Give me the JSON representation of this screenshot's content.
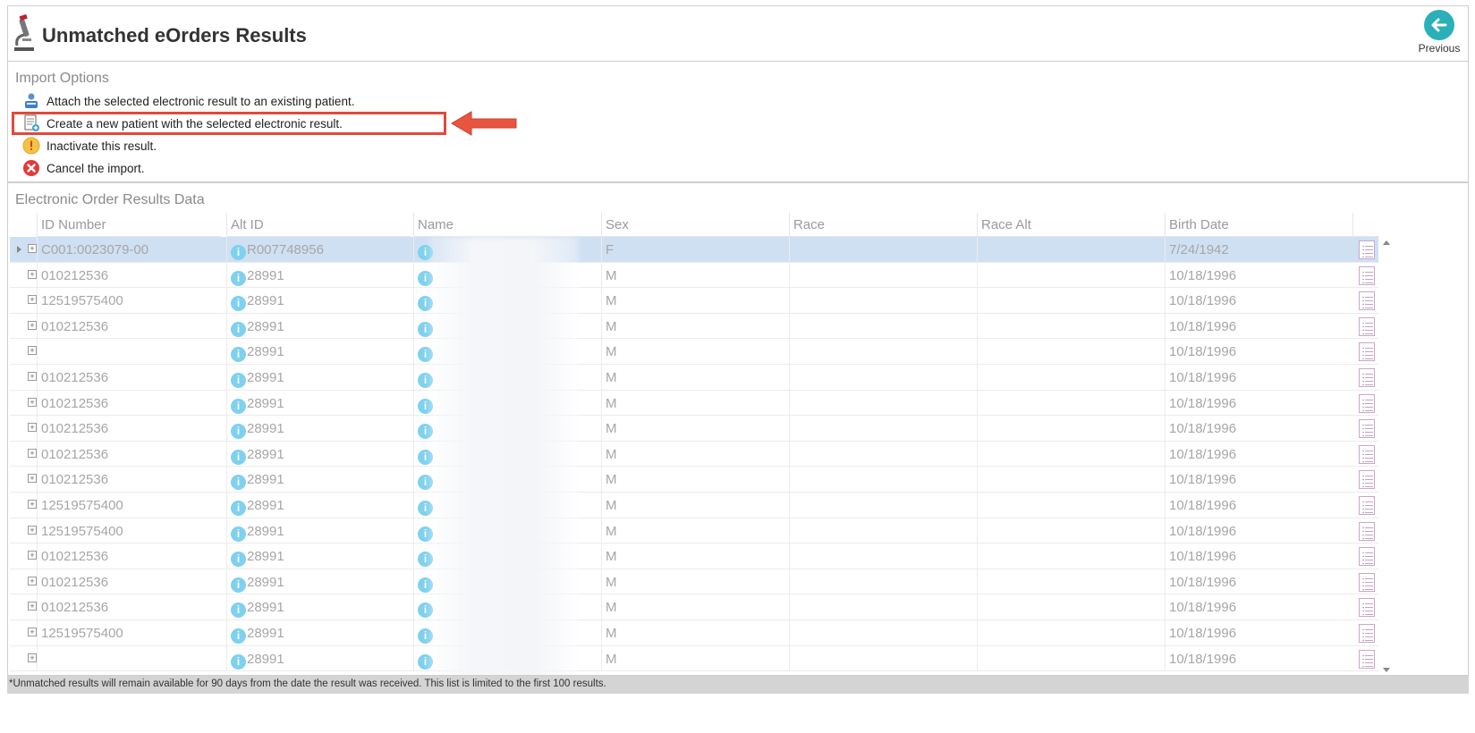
{
  "header": {
    "title": "Unmatched eOrders Results",
    "previous_label": "Previous"
  },
  "import_options": {
    "title": "Import Options",
    "items": [
      {
        "label": "Attach the selected electronic result to an existing patient.",
        "icon": "patient-attach-icon"
      },
      {
        "label": "Create a new patient with the selected electronic result.",
        "icon": "new-patient-document-icon"
      },
      {
        "label": "Inactivate this result.",
        "icon": "warning-icon"
      },
      {
        "label": "Cancel the import.",
        "icon": "cancel-icon"
      }
    ]
  },
  "data_panel": {
    "title": "Electronic Order Results Data",
    "columns": [
      "ID Number",
      "Alt ID",
      "Name",
      "Sex",
      "Race",
      "Race Alt",
      "Birth Date"
    ],
    "rows": [
      {
        "id": "C001:0023079-00",
        "alt": "R007748956",
        "sex": "F",
        "birth": "7/24/1942"
      },
      {
        "id": "010212536",
        "alt": "28991",
        "sex": "M",
        "birth": "10/18/1996"
      },
      {
        "id": "12519575400",
        "alt": "28991",
        "sex": "M",
        "birth": "10/18/1996"
      },
      {
        "id": "010212536",
        "alt": "28991",
        "sex": "M",
        "birth": "10/18/1996"
      },
      {
        "id": "",
        "alt": "28991",
        "sex": "M",
        "birth": "10/18/1996"
      },
      {
        "id": "010212536",
        "alt": "28991",
        "sex": "M",
        "birth": "10/18/1996"
      },
      {
        "id": "010212536",
        "alt": "28991",
        "sex": "M",
        "birth": "10/18/1996"
      },
      {
        "id": "010212536",
        "alt": "28991",
        "sex": "M",
        "birth": "10/18/1996"
      },
      {
        "id": "010212536",
        "alt": "28991",
        "sex": "M",
        "birth": "10/18/1996"
      },
      {
        "id": "010212536",
        "alt": "28991",
        "sex": "M",
        "birth": "10/18/1996"
      },
      {
        "id": "12519575400",
        "alt": "28991",
        "sex": "M",
        "birth": "10/18/1996"
      },
      {
        "id": "12519575400",
        "alt": "28991",
        "sex": "M",
        "birth": "10/18/1996"
      },
      {
        "id": "010212536",
        "alt": "28991",
        "sex": "M",
        "birth": "10/18/1996"
      },
      {
        "id": "010212536",
        "alt": "28991",
        "sex": "M",
        "birth": "10/18/1996"
      },
      {
        "id": "010212536",
        "alt": "28991",
        "sex": "M",
        "birth": "10/18/1996"
      },
      {
        "id": "12519575400",
        "alt": "28991",
        "sex": "M",
        "birth": "10/18/1996"
      },
      {
        "id": "",
        "alt": "28991",
        "sex": "M",
        "birth": "10/18/1996"
      }
    ]
  },
  "footer": {
    "note": "*Unmatched results will remain available for 90 days from the date the result was received. This list is limited to the first 100 results."
  },
  "colors": {
    "accent": "#2bb0b8",
    "highlight": "#e14a3b",
    "selected_row": "#cfe0f3",
    "info_icon": "#7fd1ee"
  }
}
